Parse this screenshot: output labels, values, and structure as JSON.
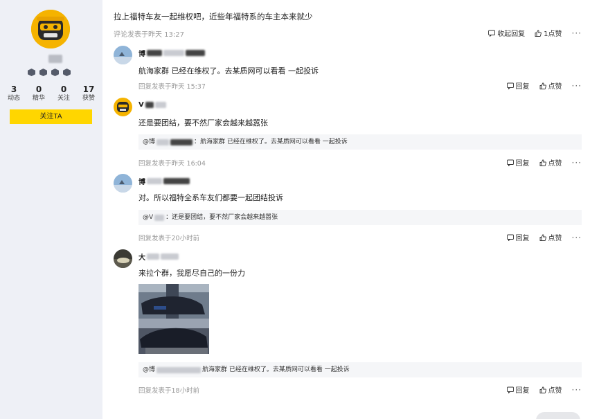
{
  "sidebar": {
    "stats": [
      {
        "value": "3",
        "label": "动态"
      },
      {
        "value": "0",
        "label": "精华"
      },
      {
        "value": "0",
        "label": "关注"
      },
      {
        "value": "17",
        "label": "获赞"
      }
    ],
    "follow_label": "关注TA"
  },
  "post": {
    "title": "拉上福特车友一起维权吧，近些年福特系的车主本来就少",
    "meta": "评论发表于昨天 13:27",
    "collapse_label": "收起回复",
    "like_label": "1点赞"
  },
  "replies": [
    {
      "name_prefix": "博",
      "text": "航海家群 已经在维权了。去某质网可以看看 一起投诉",
      "meta": "回复发表于昨天 15:37",
      "reply_label": "回复",
      "like_label": "点赞"
    },
    {
      "name_prefix": "V",
      "text": "还是要团结，要不然厂家会越来越嚣张",
      "quote_prefix": "@博",
      "quote_text": "：航海家群 已经在维权了。去某质网可以看看 一起投诉",
      "meta": "回复发表于昨天 16:04",
      "reply_label": "回复",
      "like_label": "点赞"
    },
    {
      "name_prefix": "博",
      "text": "对。所以福特全系车友们都要一起团结投诉",
      "quote_prefix": "@V",
      "quote_text": "：还是要团结，要不然厂家会越来越嚣张",
      "meta": "回复发表于20小时前",
      "reply_label": "回复",
      "like_label": "点赞"
    },
    {
      "name_prefix": "大",
      "text": "来拉个群，我愿尽自己的一份力",
      "quote_prefix": "@博",
      "quote_text": "航海家群 已经在维权了。去某质网可以看看 一起投诉",
      "meta": "回复发表于18小时前",
      "reply_label": "回复",
      "like_label": "点赞"
    }
  ],
  "more_label": "···"
}
